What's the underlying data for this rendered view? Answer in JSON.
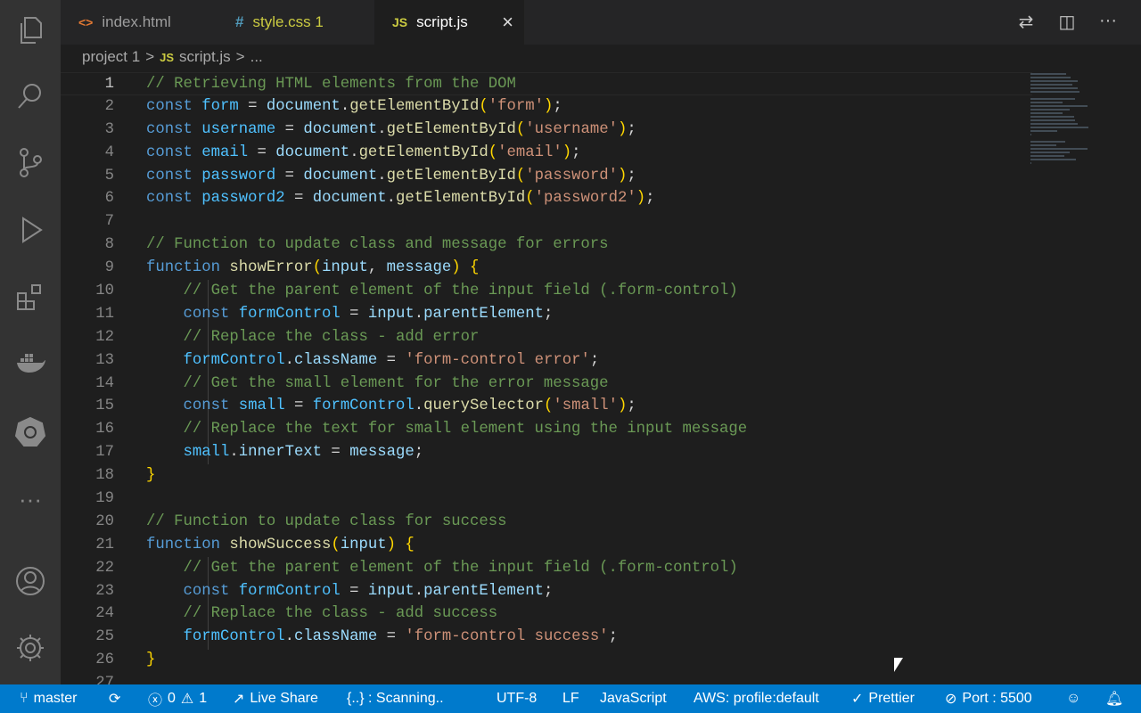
{
  "tabs": [
    {
      "label": "index.html",
      "icon": "<>",
      "icon_color": "#e37933",
      "color": "#9d9d9d"
    },
    {
      "label": "style.css 1",
      "icon": "#",
      "icon_color": "#519aba",
      "color": "#cbcb41"
    },
    {
      "label": "script.js",
      "icon": "JS",
      "icon_color": "#cbcb41",
      "color": "#ffffff",
      "close": "×"
    }
  ],
  "breadcrumb": {
    "folder": "project 1",
    "sep": ">",
    "file_icon": "JS",
    "file": "script.js",
    "more": "..."
  },
  "code": [
    [
      [
        "// Retrieving HTML elements from the DOM",
        "c"
      ]
    ],
    [
      [
        "const ",
        "k"
      ],
      [
        "form",
        "v"
      ],
      [
        " = ",
        "t"
      ],
      [
        "document",
        "p"
      ],
      [
        ".",
        "t"
      ],
      [
        "getElementById",
        "f"
      ],
      [
        "(",
        "b"
      ],
      [
        "'form'",
        "s"
      ],
      [
        ")",
        "b"
      ],
      [
        ";",
        "t"
      ]
    ],
    [
      [
        "const ",
        "k"
      ],
      [
        "username",
        "v"
      ],
      [
        " = ",
        "t"
      ],
      [
        "document",
        "p"
      ],
      [
        ".",
        "t"
      ],
      [
        "getElementById",
        "f"
      ],
      [
        "(",
        "b"
      ],
      [
        "'username'",
        "s"
      ],
      [
        ")",
        "b"
      ],
      [
        ";",
        "t"
      ]
    ],
    [
      [
        "const ",
        "k"
      ],
      [
        "email",
        "v"
      ],
      [
        " = ",
        "t"
      ],
      [
        "document",
        "p"
      ],
      [
        ".",
        "t"
      ],
      [
        "getElementById",
        "f"
      ],
      [
        "(",
        "b"
      ],
      [
        "'email'",
        "s"
      ],
      [
        ")",
        "b"
      ],
      [
        ";",
        "t"
      ]
    ],
    [
      [
        "const ",
        "k"
      ],
      [
        "password",
        "v"
      ],
      [
        " = ",
        "t"
      ],
      [
        "document",
        "p"
      ],
      [
        ".",
        "t"
      ],
      [
        "getElementById",
        "f"
      ],
      [
        "(",
        "b"
      ],
      [
        "'password'",
        "s"
      ],
      [
        ")",
        "b"
      ],
      [
        ";",
        "t"
      ]
    ],
    [
      [
        "const ",
        "k"
      ],
      [
        "password2",
        "v"
      ],
      [
        " = ",
        "t"
      ],
      [
        "document",
        "p"
      ],
      [
        ".",
        "t"
      ],
      [
        "getElementById",
        "f"
      ],
      [
        "(",
        "b"
      ],
      [
        "'password2'",
        "s"
      ],
      [
        ")",
        "b"
      ],
      [
        ";",
        "t"
      ]
    ],
    [],
    [
      [
        "// Function to update class and message for errors",
        "c"
      ]
    ],
    [
      [
        "function ",
        "k"
      ],
      [
        "showError",
        "f"
      ],
      [
        "(",
        "b"
      ],
      [
        "input",
        "p"
      ],
      [
        ", ",
        "t"
      ],
      [
        "message",
        "p"
      ],
      [
        ")",
        "b"
      ],
      [
        " ",
        "t"
      ],
      [
        "{",
        "b"
      ]
    ],
    [
      [
        "    // Get the parent element of the input field (.form-control)",
        "c"
      ]
    ],
    [
      [
        "    ",
        "t"
      ],
      [
        "const ",
        "k"
      ],
      [
        "formControl",
        "v"
      ],
      [
        " = ",
        "t"
      ],
      [
        "input",
        "p"
      ],
      [
        ".",
        "t"
      ],
      [
        "parentElement",
        "p"
      ],
      [
        ";",
        "t"
      ]
    ],
    [
      [
        "    // Replace the class - add error",
        "c"
      ]
    ],
    [
      [
        "    ",
        "t"
      ],
      [
        "formControl",
        "v"
      ],
      [
        ".",
        "t"
      ],
      [
        "className",
        "p"
      ],
      [
        " = ",
        "t"
      ],
      [
        "'form-control error'",
        "s"
      ],
      [
        ";",
        "t"
      ]
    ],
    [
      [
        "    // Get the small element for the error message",
        "c"
      ]
    ],
    [
      [
        "    ",
        "t"
      ],
      [
        "const ",
        "k"
      ],
      [
        "small",
        "v"
      ],
      [
        " = ",
        "t"
      ],
      [
        "formControl",
        "v"
      ],
      [
        ".",
        "t"
      ],
      [
        "querySelector",
        "f"
      ],
      [
        "(",
        "b"
      ],
      [
        "'small'",
        "s"
      ],
      [
        ")",
        "b"
      ],
      [
        ";",
        "t"
      ]
    ],
    [
      [
        "    // Replace the text for small element using the input message",
        "c"
      ]
    ],
    [
      [
        "    ",
        "t"
      ],
      [
        "small",
        "v"
      ],
      [
        ".",
        "t"
      ],
      [
        "innerText",
        "p"
      ],
      [
        " = ",
        "t"
      ],
      [
        "message",
        "p"
      ],
      [
        ";",
        "t"
      ]
    ],
    [
      [
        "}",
        "b"
      ]
    ],
    [],
    [
      [
        "// Function to update class for success",
        "c"
      ]
    ],
    [
      [
        "function ",
        "k"
      ],
      [
        "showSuccess",
        "f"
      ],
      [
        "(",
        "b"
      ],
      [
        "input",
        "p"
      ],
      [
        ")",
        "b"
      ],
      [
        " ",
        "t"
      ],
      [
        "{",
        "b"
      ]
    ],
    [
      [
        "    // Get the parent element of the input field (.form-control)",
        "c"
      ]
    ],
    [
      [
        "    ",
        "t"
      ],
      [
        "const ",
        "k"
      ],
      [
        "formControl",
        "v"
      ],
      [
        " = ",
        "t"
      ],
      [
        "input",
        "p"
      ],
      [
        ".",
        "t"
      ],
      [
        "parentElement",
        "p"
      ],
      [
        ";",
        "t"
      ]
    ],
    [
      [
        "    // Replace the class - add success",
        "c"
      ]
    ],
    [
      [
        "    ",
        "t"
      ],
      [
        "formControl",
        "v"
      ],
      [
        ".",
        "t"
      ],
      [
        "className",
        "p"
      ],
      [
        " = ",
        "t"
      ],
      [
        "'form-control success'",
        "s"
      ],
      [
        ";",
        "t"
      ]
    ],
    [
      [
        "}",
        "b"
      ]
    ],
    []
  ],
  "status": {
    "branch": "master",
    "errors": "0",
    "warnings": "1",
    "live_share": "Live Share",
    "scanning": "{..} : Scanning..",
    "encoding": "UTF-8",
    "eol": "LF",
    "language": "JavaScript",
    "aws": "AWS: profile:default",
    "prettier": "Prettier",
    "port": "Port : 5500"
  }
}
